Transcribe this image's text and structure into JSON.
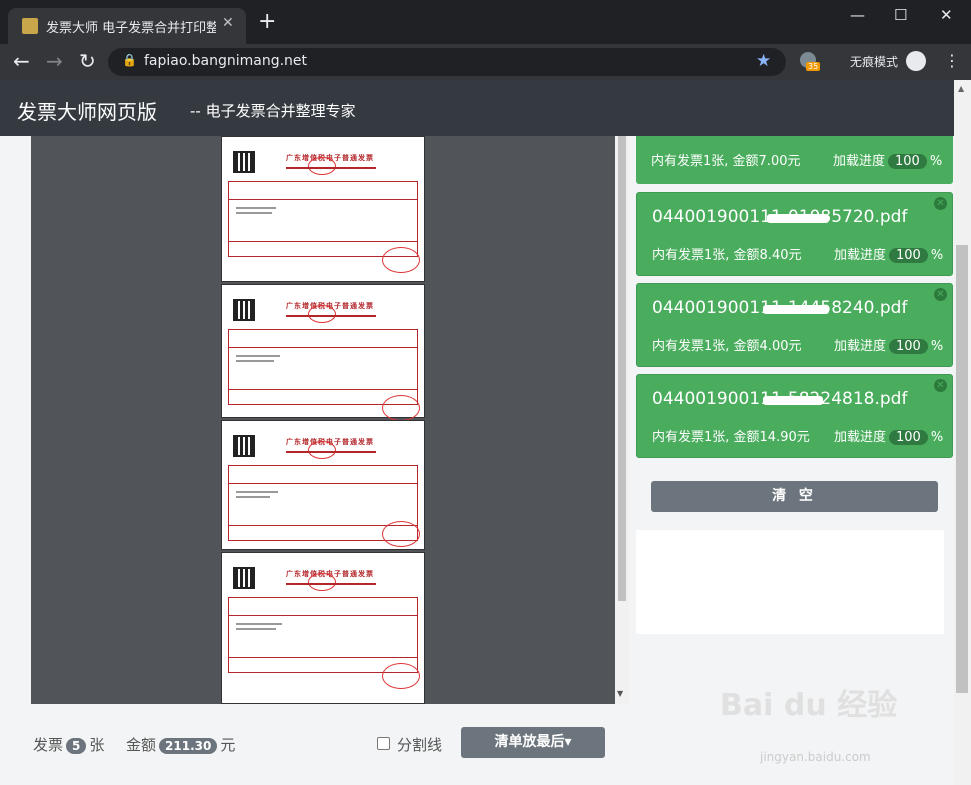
{
  "browser": {
    "tab_title": "发票大师 电子发票合并打印整理",
    "tab_close": "✕",
    "new_tab": "+",
    "url": "fapiao.bangnimang.net",
    "ext_badge": "35",
    "incognito_label": "无痕模式",
    "win_min": "—",
    "win_max": "☐",
    "win_close": "✕"
  },
  "header": {
    "brand": "发票大师网页版",
    "tagline": "-- 电子发票合并整理专家"
  },
  "invoice_preview": {
    "page_title": "广东增值税电子普通发票"
  },
  "files": [
    {
      "name": "",
      "info": "内有发票1张, 金额7.00元",
      "progress_label": "加载进度",
      "progress": "100",
      "unit": "%"
    },
    {
      "name": "044001900111-01085720.pdf",
      "info": "内有发票1张, 金额8.40元",
      "progress_label": "加载进度",
      "progress": "100",
      "unit": "%"
    },
    {
      "name": "044001900111-14458240.pdf",
      "info": "内有发票1张, 金额4.00元",
      "progress_label": "加载进度",
      "progress": "100",
      "unit": "%"
    },
    {
      "name": "044001900111-58224818.pdf",
      "info": "内有发票1张, 金额14.90元",
      "progress_label": "加载进度",
      "progress": "100",
      "unit": "%"
    }
  ],
  "clear_button": "清 空",
  "footer": {
    "invoice_label": "发票",
    "invoice_count": "5",
    "invoice_unit": "张",
    "amount_label": "金额",
    "amount_value": "211.30",
    "amount_unit": "元",
    "divider_label": "分割线",
    "order_button": "清单放最后▾"
  },
  "watermark": {
    "brand": "Bai du 经验",
    "url": "jingyan.baidu.com"
  }
}
